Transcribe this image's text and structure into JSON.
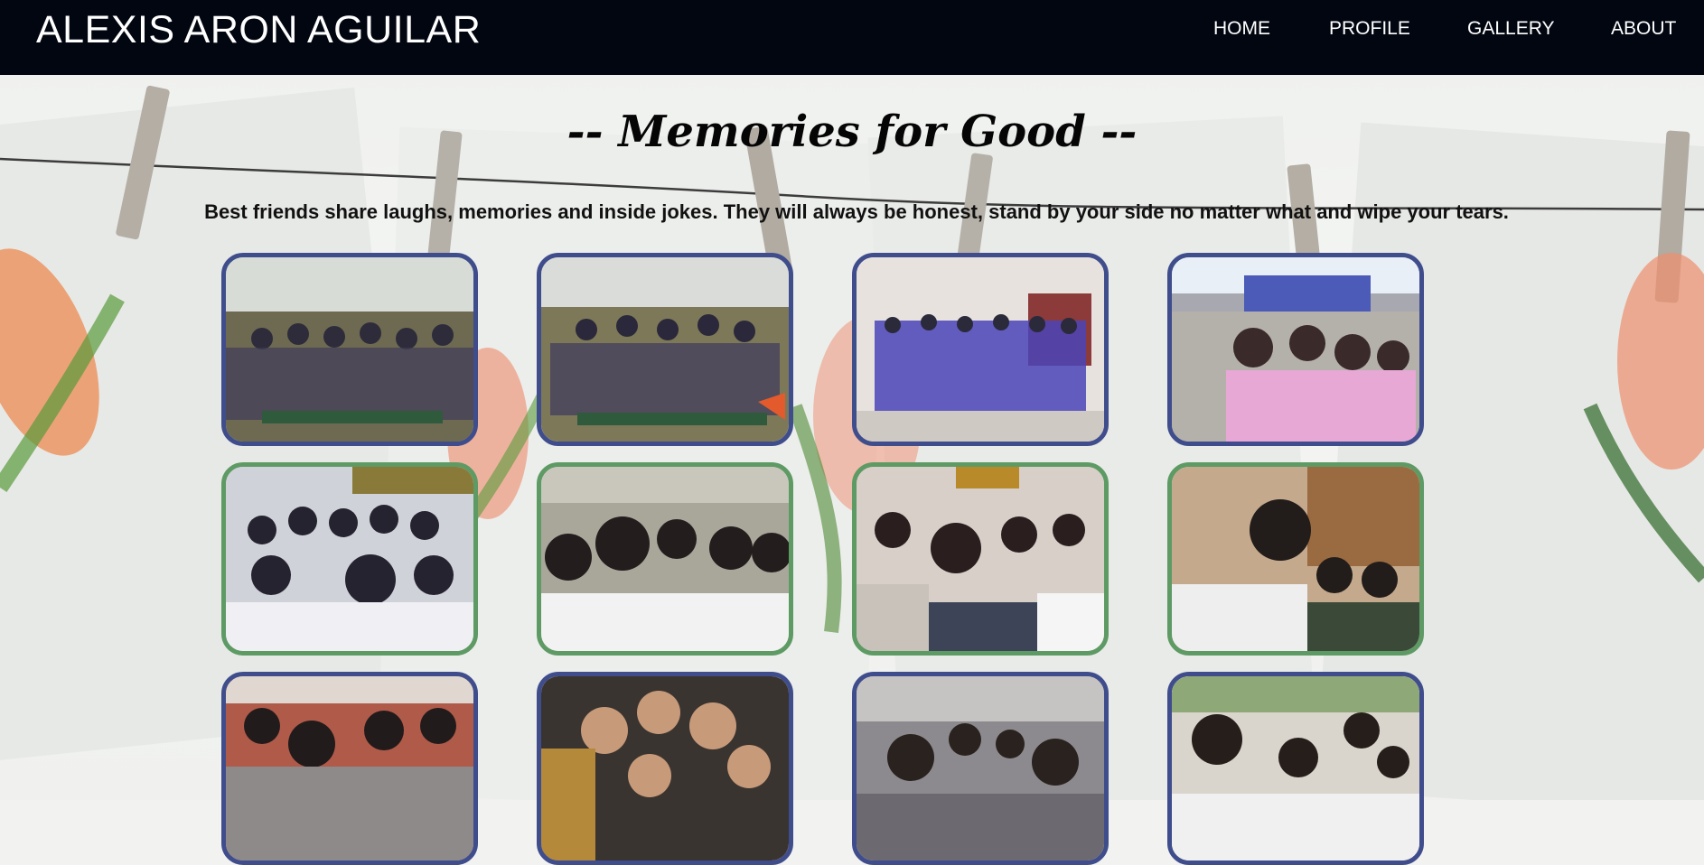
{
  "header": {
    "brand": "ALEXIS ARON AGUILAR",
    "nav": {
      "home": "HOME",
      "profile": "PROFILE",
      "gallery": "GALLERY",
      "about": "ABOUT"
    }
  },
  "main": {
    "title": "-- Memories for Good --",
    "description": "Best friends share laughs, memories and inside jokes. They will always be honest, stand by your side no matter what and wipe your tears."
  },
  "colors": {
    "navbar": "#020611",
    "frame_blue": "#404d8c",
    "frame_green": "#5e9a64"
  }
}
